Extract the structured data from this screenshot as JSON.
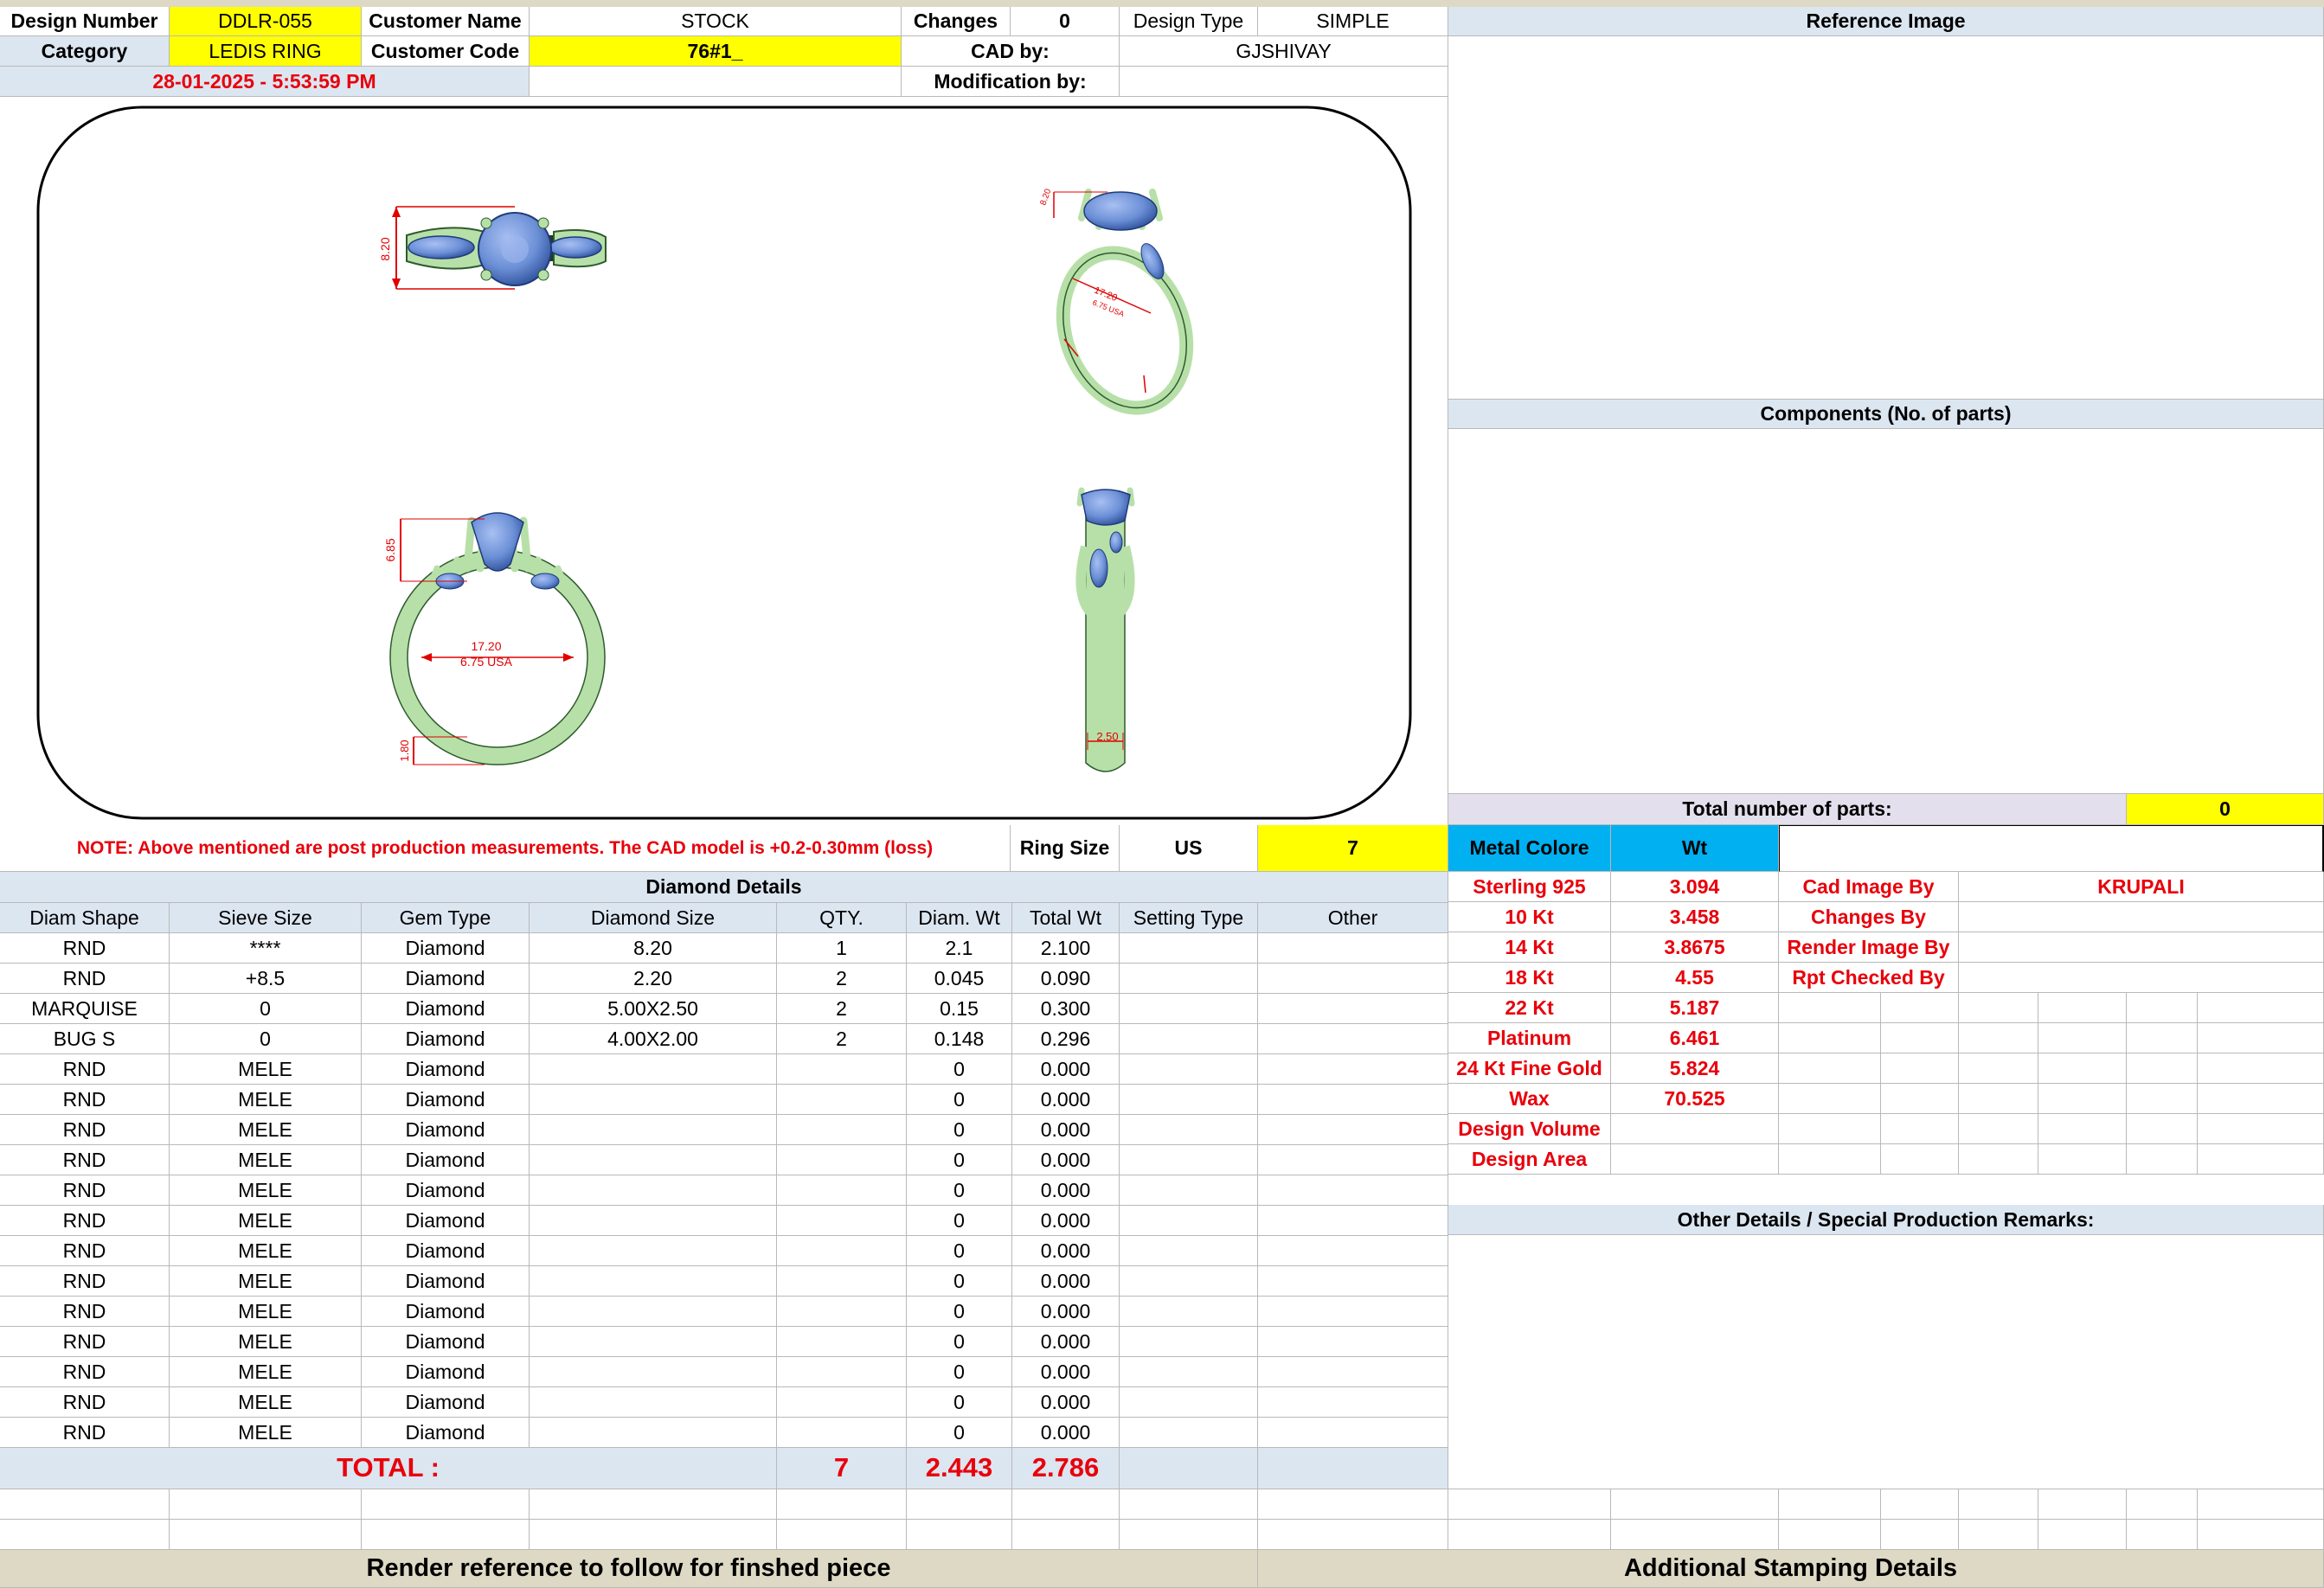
{
  "header": {
    "design_number_label": "Design Number",
    "design_number": "DDLR-055",
    "customer_name_label": "Customer Name",
    "customer_name": "STOCK",
    "changes_label": "Changes",
    "changes": "0",
    "design_type_label": "Design Type",
    "design_type": "SIMPLE",
    "category_label": "Category",
    "category": "LEDIS RING",
    "customer_code_label": "Customer Code",
    "customer_code": "76#1_",
    "cad_by_label": "CAD by:",
    "cad_by": "GJSHIVAY",
    "timestamp": "28-01-2025 - 5:53:59 PM",
    "modification_by_label": "Modification by:",
    "modification_by": ""
  },
  "drawing": {
    "dims": {
      "top_height": "8.20",
      "side_height": "6.85",
      "inner_dia": "17.20",
      "ring_size_usa": "6.75 USA",
      "shank_thickness": "1.80",
      "shank_width": "2.50"
    }
  },
  "note": {
    "text": "NOTE: Above mentioned are post production measurements. The CAD model is +0.2-0.30mm (loss)",
    "ring_size_label": "Ring Size",
    "ring_size_unit": "US",
    "ring_size_value": "7"
  },
  "right_panel": {
    "reference_image_label": "Reference Image",
    "components_label": "Components (No. of parts)",
    "total_parts_label": "Total number of parts:",
    "total_parts_value": "0",
    "metal_color_label": "Metal Colore",
    "wt_label": "Wt",
    "metals": [
      {
        "name": "Sterling 925",
        "wt": "3.094"
      },
      {
        "name": "10 Kt",
        "wt": "3.458"
      },
      {
        "name": "14 Kt",
        "wt": "3.8675"
      },
      {
        "name": "18 Kt",
        "wt": "4.55"
      },
      {
        "name": "22 Kt",
        "wt": "5.187"
      },
      {
        "name": "Platinum",
        "wt": "6.461"
      },
      {
        "name": "24 Kt Fine Gold",
        "wt": "5.824"
      },
      {
        "name": "Wax",
        "wt": "70.525"
      },
      {
        "name": "Design Volume",
        "wt": ""
      },
      {
        "name": "Design Area",
        "wt": ""
      }
    ],
    "credits": [
      {
        "label": "Cad Image By",
        "value": "KRUPALI"
      },
      {
        "label": "Changes By",
        "value": ""
      },
      {
        "label": "Render Image By",
        "value": ""
      },
      {
        "label": "Rpt Checked By",
        "value": ""
      }
    ],
    "remarks_label": "Other Details / Special Production Remarks:"
  },
  "diamond_details": {
    "title": "Diamond Details",
    "columns": [
      "Diam Shape",
      "Sieve Size",
      "Gem Type",
      "Diamond Size",
      "QTY.",
      "Diam. Wt",
      "Total Wt",
      "Setting Type",
      "Other"
    ],
    "rows": [
      [
        "RND",
        "****",
        "Diamond",
        "8.20",
        "1",
        "2.1",
        "2.100",
        "",
        ""
      ],
      [
        "RND",
        "+8.5",
        "Diamond",
        "2.20",
        "2",
        "0.045",
        "0.090",
        "",
        ""
      ],
      [
        "MARQUISE",
        "0",
        "Diamond",
        "5.00X2.50",
        "2",
        "0.15",
        "0.300",
        "",
        ""
      ],
      [
        "BUG S",
        "0",
        "Diamond",
        "4.00X2.00",
        "2",
        "0.148",
        "0.296",
        "",
        ""
      ],
      [
        "RND",
        "MELE",
        "Diamond",
        "",
        "",
        "0",
        "0.000",
        "",
        ""
      ],
      [
        "RND",
        "MELE",
        "Diamond",
        "",
        "",
        "0",
        "0.000",
        "",
        ""
      ],
      [
        "RND",
        "MELE",
        "Diamond",
        "",
        "",
        "0",
        "0.000",
        "",
        ""
      ],
      [
        "RND",
        "MELE",
        "Diamond",
        "",
        "",
        "0",
        "0.000",
        "",
        ""
      ],
      [
        "RND",
        "MELE",
        "Diamond",
        "",
        "",
        "0",
        "0.000",
        "",
        ""
      ],
      [
        "RND",
        "MELE",
        "Diamond",
        "",
        "",
        "0",
        "0.000",
        "",
        ""
      ],
      [
        "RND",
        "MELE",
        "Diamond",
        "",
        "",
        "0",
        "0.000",
        "",
        ""
      ],
      [
        "RND",
        "MELE",
        "Diamond",
        "",
        "",
        "0",
        "0.000",
        "",
        ""
      ],
      [
        "RND",
        "MELE",
        "Diamond",
        "",
        "",
        "0",
        "0.000",
        "",
        ""
      ],
      [
        "RND",
        "MELE",
        "Diamond",
        "",
        "",
        "0",
        "0.000",
        "",
        ""
      ],
      [
        "RND",
        "MELE",
        "Diamond",
        "",
        "",
        "0",
        "0.000",
        "",
        ""
      ],
      [
        "RND",
        "MELE",
        "Diamond",
        "",
        "",
        "0",
        "0.000",
        "",
        ""
      ],
      [
        "RND",
        "MELE",
        "Diamond",
        "",
        "",
        "0",
        "0.000",
        "",
        ""
      ]
    ],
    "total_label": "TOTAL :",
    "total_qty": "7",
    "total_diam_wt": "2.443",
    "total_wt": "2.786"
  },
  "footer": {
    "render_reference": "Render reference to follow for finshed piece",
    "stamping_details": "Additional Stamping Details"
  },
  "colors": {
    "highlight_yellow": "#ffff00",
    "header_blue": "#dce6f1",
    "metal_cyan": "#00b0f0",
    "total_lavender": "#e4dfec",
    "footer_beige": "#ddd9c4",
    "metal_green": "#b7e0a8",
    "gem_blue": "#6b8fd6",
    "dim_red": "#e00000",
    "warn_red": "#e8000b"
  }
}
